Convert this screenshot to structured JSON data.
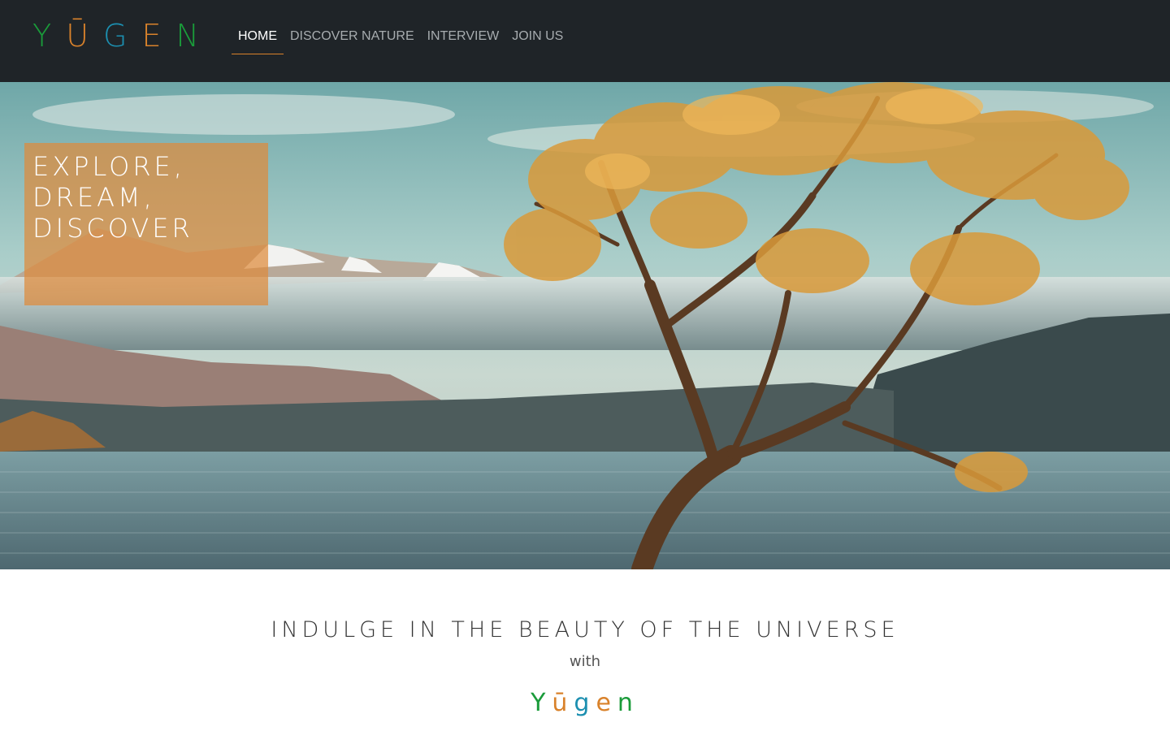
{
  "brand": {
    "letters": [
      {
        "char": "Y",
        "color": "#1a9b3a"
      },
      {
        "char": "Ū",
        "color": "#d9822b"
      },
      {
        "char": "G",
        "color": "#1c8fb0"
      },
      {
        "char": "E",
        "color": "#d9822b"
      },
      {
        "char": "N",
        "color": "#1a9b3a"
      }
    ]
  },
  "nav": {
    "items": [
      {
        "label": "HOME",
        "active": true
      },
      {
        "label": "DISCOVER NATURE",
        "active": false
      },
      {
        "label": "INTERVIEW",
        "active": false
      },
      {
        "label": "JOIN US",
        "active": false
      }
    ]
  },
  "hero": {
    "lines": [
      "EXPLORE,",
      "DREAM,",
      "DISCOVER"
    ],
    "box_color": "#de8b3c"
  },
  "section": {
    "tagline": "INDULGE IN THE BEAUTY OF THE UNIVERSE",
    "with": "with",
    "logo_letters": [
      {
        "char": "Y",
        "color": "#1a9b3a"
      },
      {
        "char": "ū",
        "color": "#d9822b"
      },
      {
        "char": "g",
        "color": "#1c8fb0"
      },
      {
        "char": "e",
        "color": "#d9822b"
      },
      {
        "char": "n",
        "color": "#1a9b3a"
      }
    ]
  },
  "colors": {
    "navbar": "#1f2428",
    "accent": "#d9822b"
  }
}
